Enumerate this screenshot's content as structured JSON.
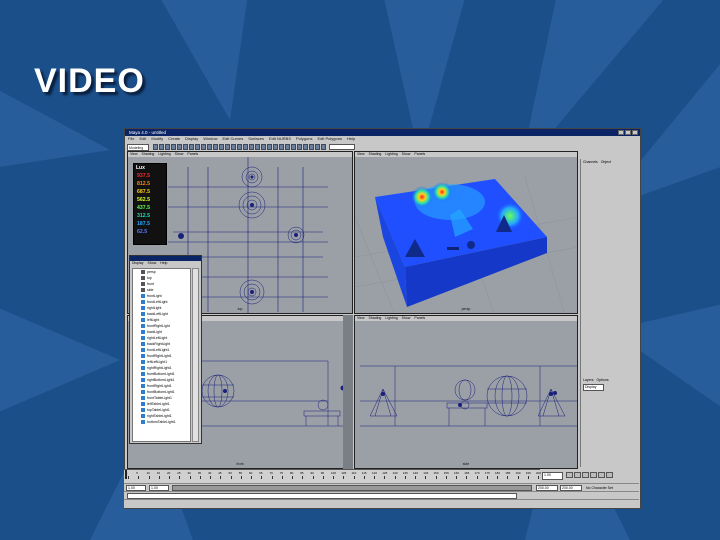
{
  "slide": {
    "title": "VIDEO"
  },
  "app": {
    "window_title": "Maya 4.0 - untitled",
    "menus": [
      "File",
      "Edit",
      "Modify",
      "Create",
      "Display",
      "Window",
      "Edit Curves",
      "Surfaces",
      "Edit NURBS",
      "Polygons",
      "Edit Polygons",
      "Help"
    ],
    "mode_dropdown": "Modeling",
    "viewport_menus": [
      "View",
      "Shading",
      "Lighting",
      "Show",
      "Panels"
    ],
    "viewports": {
      "top_left": {
        "label": "top"
      },
      "top_right": {
        "label": "persp"
      },
      "bottom_left": {
        "label": "front"
      },
      "bottom_right": {
        "label": "side"
      }
    },
    "legend": {
      "header": "Lux",
      "values": [
        "937.5",
        "812.5",
        "687.5",
        "562.5",
        "437.5",
        "312.5",
        "187.5",
        "62.5"
      ],
      "colors": [
        "#ff2a2a",
        "#ff8a1a",
        "#ffd21a",
        "#d8ff2a",
        "#66ff55",
        "#22e0b0",
        "#22a8ff",
        "#2a50ff"
      ]
    },
    "outliner": {
      "menus": [
        "Display",
        "Show",
        "Help"
      ],
      "items": [
        "persp",
        "top",
        "front",
        "side",
        "frontLight",
        "frontLeftLight",
        "rightLight",
        "backLeftLight",
        "leftLight",
        "frontRightLight",
        "backLight",
        "rightLeftLight",
        "backRightLight",
        "frontLeftLight1",
        "frontRightLight1",
        "leftLeftLight1",
        "rightRightLight1",
        "frontBottomLight1",
        "rightBottomLight1",
        "frontRightLight1",
        "frontBottomLight1",
        "frontTableLight1",
        "leftTableLight1",
        "topTableLight1",
        "rightTableLight1",
        "bottomTableLight1"
      ]
    },
    "channel_box": {
      "tabs": [
        "Channels",
        "Object"
      ]
    },
    "layer_editor": {
      "tabs": [
        "Layers",
        "Options"
      ],
      "dropdown": "Display"
    },
    "timeline": {
      "ticks": [
        "1",
        "5",
        "10",
        "15",
        "20",
        "25",
        "30",
        "35",
        "40",
        "45",
        "50",
        "55",
        "60",
        "65",
        "70",
        "75",
        "80",
        "85",
        "90",
        "95",
        "100",
        "105",
        "110",
        "115",
        "120",
        "125",
        "130",
        "135",
        "140",
        "145",
        "150",
        "155",
        "160",
        "165",
        "170",
        "175",
        "180",
        "185",
        "190",
        "195",
        "200"
      ],
      "current_frame": "1.00"
    },
    "range": {
      "start": "1.00",
      "inner_start": "1.00",
      "inner_end": "200.00",
      "end": "200.00",
      "char_set": "No Character Set"
    },
    "colors": {
      "viewport_grey": "#9aa0a6",
      "wire_blue": "#1a1f7a",
      "heat_blue": "#1f4fff"
    }
  }
}
